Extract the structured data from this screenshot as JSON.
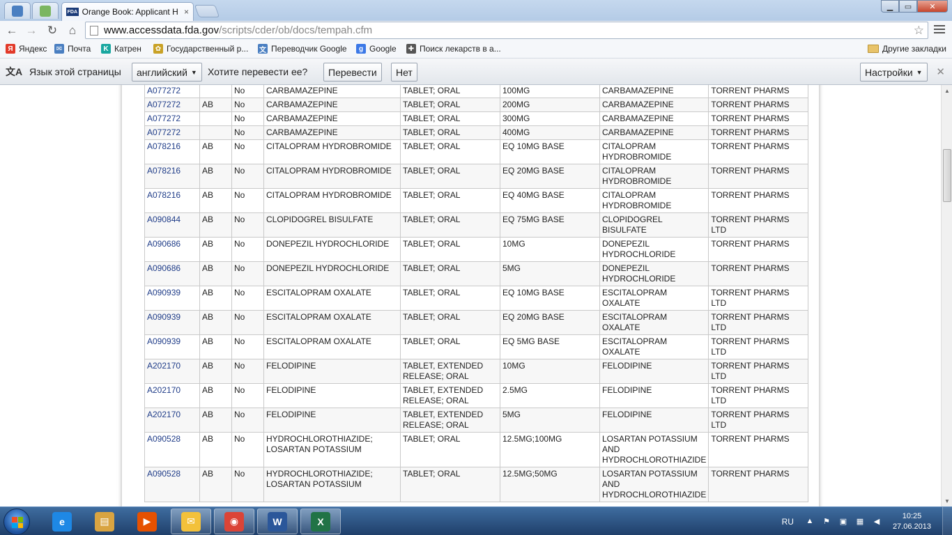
{
  "browser": {
    "tab_title": "Orange Book: Applicant H",
    "tab_close": "×",
    "url_host": "www.accessdata.fda.gov",
    "url_path": "/scripts/cder/ob/docs/tempah.cfm",
    "favicon_text": "FDA"
  },
  "window_buttons": {
    "minimize": "▁",
    "maximize": "▭",
    "close": "✕"
  },
  "bookmarks": [
    {
      "label": "Яндекс",
      "icon": "yandex-icon",
      "color": "#e23a2a",
      "glyph": "Я"
    },
    {
      "label": "Почта",
      "icon": "mail-icon",
      "color": "#4a7fc1",
      "glyph": "✉"
    },
    {
      "label": "Катрен",
      "icon": "katren-icon",
      "color": "#19a7a0",
      "glyph": "K"
    },
    {
      "label": "Государственный р...",
      "icon": "gov-icon",
      "color": "#c9a227",
      "glyph": "✿"
    },
    {
      "label": "Переводчик Google",
      "icon": "translate-icon",
      "color": "#4a7fc1",
      "glyph": "文"
    },
    {
      "label": "Google",
      "icon": "google-icon",
      "color": "#3b78e7",
      "glyph": "g"
    },
    {
      "label": "Поиск лекарств в а...",
      "icon": "pill-icon",
      "color": "#555555",
      "glyph": "✚"
    }
  ],
  "other_bookmarks": "Другие закладки",
  "translate_bar": {
    "page_language_label": "Язык этой страницы",
    "language_value": "английский",
    "question": "Хотите перевести ее?",
    "translate_button": "Перевести",
    "no_button": "Нет",
    "settings_button": "Настройки",
    "close": "✕"
  },
  "table": {
    "rows": [
      [
        "A077272",
        "",
        "No",
        "CARBAMAZEPINE",
        "TABLET; ORAL",
        "100MG",
        "CARBAMAZEPINE",
        "TORRENT PHARMS"
      ],
      [
        "A077272",
        "AB",
        "No",
        "CARBAMAZEPINE",
        "TABLET; ORAL",
        "200MG",
        "CARBAMAZEPINE",
        "TORRENT PHARMS"
      ],
      [
        "A077272",
        "",
        "No",
        "CARBAMAZEPINE",
        "TABLET; ORAL",
        "300MG",
        "CARBAMAZEPINE",
        "TORRENT PHARMS"
      ],
      [
        "A077272",
        "",
        "No",
        "CARBAMAZEPINE",
        "TABLET; ORAL",
        "400MG",
        "CARBAMAZEPINE",
        "TORRENT PHARMS"
      ],
      [
        "A078216",
        "AB",
        "No",
        "CITALOPRAM HYDROBROMIDE",
        "TABLET; ORAL",
        "EQ 10MG BASE",
        "CITALOPRAM HYDROBROMIDE",
        "TORRENT PHARMS"
      ],
      [
        "A078216",
        "AB",
        "No",
        "CITALOPRAM HYDROBROMIDE",
        "TABLET; ORAL",
        "EQ 20MG BASE",
        "CITALOPRAM HYDROBROMIDE",
        "TORRENT PHARMS"
      ],
      [
        "A078216",
        "AB",
        "No",
        "CITALOPRAM HYDROBROMIDE",
        "TABLET; ORAL",
        "EQ 40MG BASE",
        "CITALOPRAM HYDROBROMIDE",
        "TORRENT PHARMS"
      ],
      [
        "A090844",
        "AB",
        "No",
        "CLOPIDOGREL BISULFATE",
        "TABLET; ORAL",
        "EQ 75MG BASE",
        "CLOPIDOGREL BISULFATE",
        "TORRENT PHARMS LTD"
      ],
      [
        "A090686",
        "AB",
        "No",
        "DONEPEZIL HYDROCHLORIDE",
        "TABLET; ORAL",
        "10MG",
        "DONEPEZIL HYDROCHLORIDE",
        "TORRENT PHARMS"
      ],
      [
        "A090686",
        "AB",
        "No",
        "DONEPEZIL HYDROCHLORIDE",
        "TABLET; ORAL",
        "5MG",
        "DONEPEZIL HYDROCHLORIDE",
        "TORRENT PHARMS"
      ],
      [
        "A090939",
        "AB",
        "No",
        "ESCITALOPRAM OXALATE",
        "TABLET; ORAL",
        "EQ 10MG BASE",
        "ESCITALOPRAM OXALATE",
        "TORRENT PHARMS LTD"
      ],
      [
        "A090939",
        "AB",
        "No",
        "ESCITALOPRAM OXALATE",
        "TABLET; ORAL",
        "EQ 20MG BASE",
        "ESCITALOPRAM OXALATE",
        "TORRENT PHARMS LTD"
      ],
      [
        "A090939",
        "AB",
        "No",
        "ESCITALOPRAM OXALATE",
        "TABLET; ORAL",
        "EQ 5MG BASE",
        "ESCITALOPRAM OXALATE",
        "TORRENT PHARMS LTD"
      ],
      [
        "A202170",
        "AB",
        "No",
        "FELODIPINE",
        "TABLET, EXTENDED RELEASE; ORAL",
        "10MG",
        "FELODIPINE",
        "TORRENT PHARMS LTD"
      ],
      [
        "A202170",
        "AB",
        "No",
        "FELODIPINE",
        "TABLET, EXTENDED RELEASE; ORAL",
        "2.5MG",
        "FELODIPINE",
        "TORRENT PHARMS LTD"
      ],
      [
        "A202170",
        "AB",
        "No",
        "FELODIPINE",
        "TABLET, EXTENDED RELEASE; ORAL",
        "5MG",
        "FELODIPINE",
        "TORRENT PHARMS LTD"
      ],
      [
        "A090528",
        "AB",
        "No",
        "HYDROCHLOROTHIAZIDE; LOSARTAN POTASSIUM",
        "TABLET; ORAL",
        "12.5MG;100MG",
        "LOSARTAN POTASSIUM AND HYDROCHLOROTHIAZIDE",
        "TORRENT PHARMS"
      ],
      [
        "A090528",
        "AB",
        "No",
        "HYDROCHLOROTHIAZIDE; LOSARTAN POTASSIUM",
        "TABLET; ORAL",
        "12.5MG;50MG",
        "LOSARTAN POTASSIUM AND HYDROCHLOROTHIAZIDE",
        "TORRENT PHARMS"
      ]
    ]
  },
  "taskbar": {
    "apps": [
      {
        "name": "taskbar-ie",
        "glyph": "e",
        "color": "#1e88e5"
      },
      {
        "name": "taskbar-explorer",
        "glyph": "▤",
        "color": "#d9a441"
      },
      {
        "name": "taskbar-media-player",
        "glyph": "▶",
        "color": "#e65100"
      },
      {
        "name": "taskbar-outlook",
        "glyph": "✉",
        "color": "#f3c13a"
      },
      {
        "name": "taskbar-chrome",
        "glyph": "◉",
        "color": "#db4437"
      },
      {
        "name": "taskbar-word",
        "glyph": "W",
        "color": "#2b579a"
      },
      {
        "name": "taskbar-excel",
        "glyph": "X",
        "color": "#217346"
      }
    ],
    "lang": "RU",
    "time": "10:25",
    "date": "27.06.2013"
  }
}
